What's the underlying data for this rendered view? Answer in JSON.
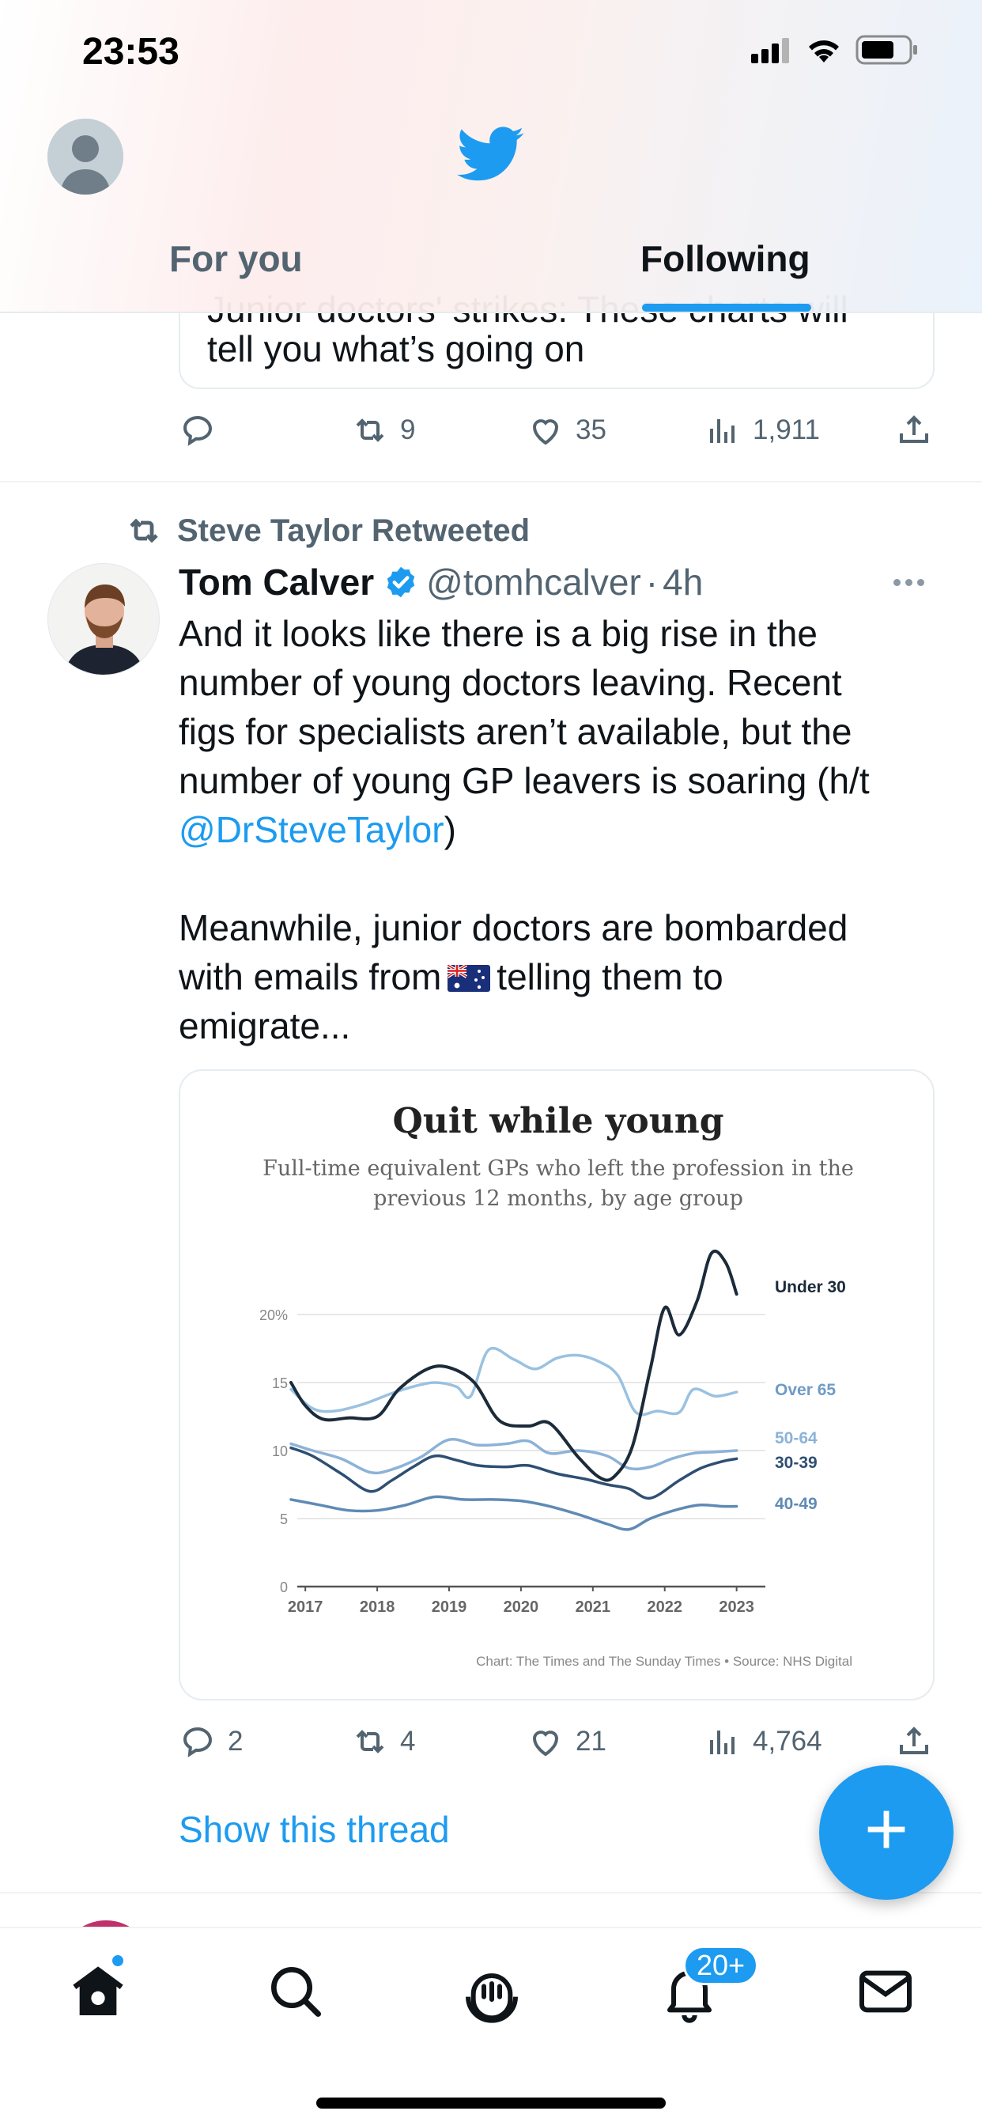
{
  "status_bar": {
    "time": "23:53"
  },
  "header": {
    "tabs": [
      {
        "label": "For you"
      },
      {
        "label": "Following"
      }
    ],
    "active_tab": "Following"
  },
  "previous_tweet": {
    "card_line_1": "Junior doctors' strikes: These charts will",
    "card_line_2": "tell you what’s going on",
    "actions": {
      "replies": "",
      "retweets": "9",
      "likes": "35",
      "views": "1,911"
    }
  },
  "tweet": {
    "retweeted_by": "Steve Taylor Retweeted",
    "author_name": "Tom Calver",
    "handle": "@tomhcalver",
    "separator": "·",
    "time": "4h",
    "text_lines": [
      "And it looks like there is a big rise in the",
      "number of young doctors leaving. Recent",
      "figs for specialists aren’t available, but the",
      "number of young GP leavers is soaring (h/t",
      ""
    ],
    "mention": "@DrSteveTaylor",
    "mention_suffix": ")",
    "text_lines_2": [
      "Meanwhile, junior doctors are bombarded",
      "with emails from",
      "emigrate..."
    ],
    "text_line_2b_suffix": "telling them to",
    "actions": {
      "replies": "2",
      "retweets": "4",
      "likes": "21",
      "views": "4,764"
    },
    "show_thread": "Show this thread"
  },
  "chart_data": {
    "type": "line",
    "title": "Quit while young",
    "subtitle_line_1": "Full-time equivalent GPs who left the profession in the",
    "subtitle_line_2": "previous 12 months, by age group",
    "source": "Chart: The Times and The Sunday Times • Source: NHS Digital",
    "x_tick_labels": [
      "2017",
      "2018",
      "2019",
      "2020",
      "2021",
      "2022",
      "2023"
    ],
    "y_tick_labels": [
      "0",
      "5",
      "10",
      "15",
      "20%"
    ],
    "y_ticks": [
      0,
      5,
      10,
      15,
      20
    ],
    "xlim": [
      2016.8,
      2023.4
    ],
    "ylim": [
      0,
      20
    ],
    "grid": true,
    "series": [
      {
        "name": "Under 30",
        "color": "#1c2b3a",
        "x": [
          2016.8,
          2017.0,
          2017.25,
          2017.6,
          2018.0,
          2018.3,
          2018.7,
          2019.0,
          2019.35,
          2019.7,
          2020.1,
          2020.4,
          2020.8,
          2021.1,
          2021.3,
          2021.55,
          2021.8,
          2022.0,
          2022.2,
          2022.45,
          2022.65,
          2022.85,
          2023.0
        ],
        "y": [
          15,
          13.3,
          12.3,
          12.4,
          12.5,
          14.5,
          16.0,
          16.1,
          15.0,
          12.2,
          11.8,
          12.0,
          9.5,
          8.0,
          8.1,
          10.3,
          16.0,
          20.5,
          18.5,
          21.0,
          24.5,
          23.8,
          21.5
        ]
      },
      {
        "name": "Over 65",
        "color": "#9ac1e0",
        "x": [
          2016.8,
          2017.1,
          2017.4,
          2017.8,
          2018.2,
          2018.5,
          2018.8,
          2019.1,
          2019.3,
          2019.55,
          2019.9,
          2020.2,
          2020.5,
          2020.8,
          2021.1,
          2021.35,
          2021.6,
          2021.9,
          2022.2,
          2022.4,
          2022.7,
          2023.0
        ],
        "y": [
          14.5,
          13.1,
          12.9,
          13.4,
          14.2,
          14.7,
          15.0,
          14.7,
          14.0,
          17.4,
          16.7,
          16.0,
          16.8,
          17.0,
          16.5,
          15.5,
          12.8,
          12.9,
          12.8,
          14.5,
          14.0,
          14.3
        ]
      },
      {
        "name": "50-64",
        "color": "#8cb2d8",
        "x": [
          2016.8,
          2017.1,
          2017.5,
          2017.9,
          2018.2,
          2018.6,
          2019.0,
          2019.4,
          2019.8,
          2020.1,
          2020.4,
          2020.8,
          2021.2,
          2021.5,
          2021.8,
          2022.1,
          2022.4,
          2022.7,
          2023.0
        ],
        "y": [
          10.5,
          10.0,
          9.4,
          8.4,
          8.6,
          9.5,
          10.8,
          10.4,
          10.5,
          10.7,
          9.8,
          10.0,
          9.6,
          8.7,
          8.8,
          9.4,
          9.8,
          9.9,
          10.0
        ]
      },
      {
        "name": "30-39",
        "color": "#2e4f72",
        "x": [
          2016.8,
          2017.1,
          2017.5,
          2017.9,
          2018.2,
          2018.5,
          2018.8,
          2019.1,
          2019.4,
          2019.8,
          2020.1,
          2020.5,
          2020.9,
          2021.2,
          2021.5,
          2021.8,
          2022.2,
          2022.5,
          2022.8,
          2023.0
        ],
        "y": [
          10.2,
          9.6,
          8.3,
          7.0,
          7.8,
          8.8,
          9.6,
          9.3,
          8.9,
          8.8,
          8.9,
          8.3,
          7.9,
          7.5,
          7.2,
          6.5,
          7.8,
          8.7,
          9.2,
          9.4
        ]
      },
      {
        "name": "40-49",
        "color": "#5f8ab5",
        "x": [
          2016.8,
          2017.2,
          2017.6,
          2018.0,
          2018.4,
          2018.8,
          2019.2,
          2019.6,
          2020.0,
          2020.4,
          2020.8,
          2021.2,
          2021.5,
          2021.8,
          2022.2,
          2022.5,
          2022.8,
          2023.0
        ],
        "y": [
          6.4,
          6.0,
          5.6,
          5.6,
          6.0,
          6.6,
          6.4,
          6.4,
          6.3,
          5.9,
          5.3,
          4.6,
          4.2,
          5.0,
          5.7,
          6.0,
          5.9,
          5.9
        ]
      }
    ]
  },
  "bottom_nav": {
    "notification_badge": "20+"
  },
  "icons": [
    "avatar-icon",
    "bird-logo-icon",
    "reply-icon",
    "retweet-icon",
    "like-icon",
    "views-icon",
    "share-icon",
    "verified-icon",
    "more-icon",
    "australia-flag-icon",
    "plus-icon",
    "home-icon",
    "search-icon",
    "spaces-icon",
    "bell-icon",
    "mail-icon"
  ],
  "colors": {
    "accent": "#1d9bf0",
    "text": "#0f1419",
    "secondary": "#536471"
  }
}
